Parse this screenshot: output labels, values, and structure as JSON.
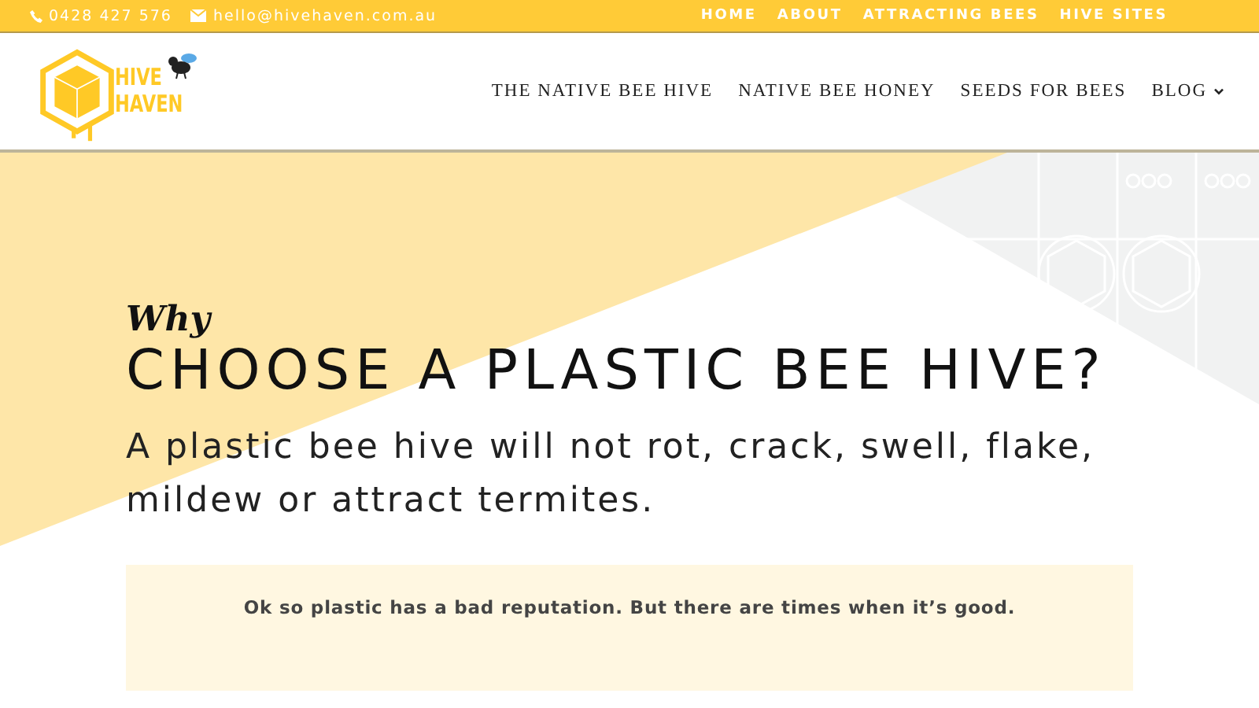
{
  "top_bar": {
    "phone": "0428 427 576",
    "email": "hello@hivehaven.com.au",
    "links": [
      {
        "label": "HOME"
      },
      {
        "label": "ABOUT"
      },
      {
        "label": "ATTRACTING BEES"
      },
      {
        "label": "HIVE SITES"
      }
    ]
  },
  "header": {
    "logo_lines": [
      "HIVE",
      "HAVEN"
    ],
    "nav": [
      {
        "label": "THE NATIVE BEE HIVE",
        "has_dropdown": false
      },
      {
        "label": "NATIVE BEE HONEY",
        "has_dropdown": false
      },
      {
        "label": "SEEDS FOR BEES",
        "has_dropdown": false
      },
      {
        "label": "BLOG",
        "has_dropdown": true
      }
    ]
  },
  "hero": {
    "kicker": "Why",
    "title": "CHOOSE A PLASTIC BEE HIVE?",
    "subtitle": "A plastic bee hive will not rot, crack, swell, flake, mildew or attract termites."
  },
  "callout": {
    "text": "Ok so plastic has a bad reputation. But there are times when it’s good."
  }
}
